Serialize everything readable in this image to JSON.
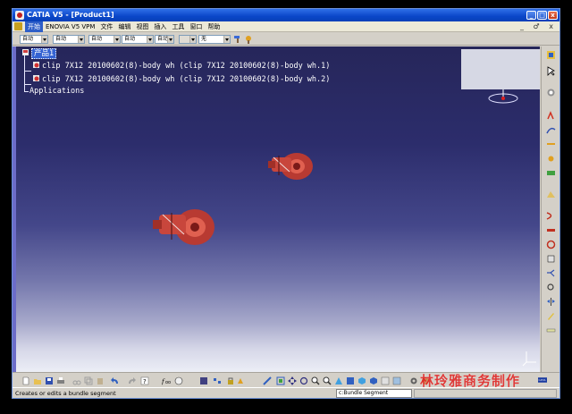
{
  "window": {
    "title": "CATIA V5 - [Product1]",
    "caption_buttons": [
      "_",
      "□",
      "x"
    ]
  },
  "menubar": {
    "items": [
      "开始",
      "ENOVIA V5 VPM",
      "文件",
      "编辑",
      "视图",
      "插入",
      "工具",
      "窗口",
      "帮助"
    ],
    "mdi_buttons": "_ ♂ x"
  },
  "options_bar": {
    "combos": [
      {
        "value": "自动",
        "disabled": false
      },
      {
        "value": "自动",
        "disabled": false
      },
      {
        "value": "自动",
        "disabled": false
      },
      {
        "value": "自动",
        "disabled": false
      },
      {
        "value": "自动",
        "disabled": false
      },
      {
        "value": "",
        "disabled": true
      },
      {
        "value": "无",
        "disabled": false
      }
    ]
  },
  "tree": {
    "root": "产品1",
    "children": [
      "clip 7X12 20100602(8)-body wh (clip 7X12 20100602(8)-body wh.1)",
      "clip 7X12 20100602(8)-body wh (clip 7X12 20100602(8)-body wh.2)"
    ],
    "applications": "Applications"
  },
  "statusbar": {
    "message": "Creates or edits a bundle segment",
    "command": "c:Bundle Segment"
  },
  "watermark": "林玲雅商务制作",
  "colors": {
    "title_bar": "#0a46c8",
    "viewport_top": "#26265a",
    "viewport_bottom": "#eceef6",
    "part_red": "#c8463c",
    "selection": "#3462d2"
  }
}
